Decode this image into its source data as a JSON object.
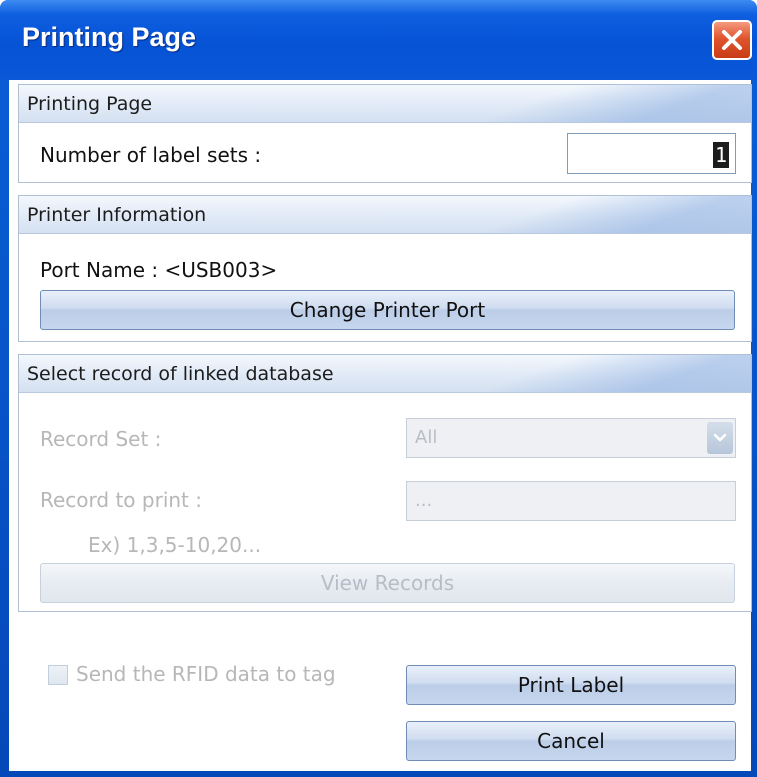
{
  "window": {
    "title": "Printing Page"
  },
  "printing_page": {
    "header": "Printing Page",
    "label_sets_label": "Number of label sets :",
    "label_sets_value": "1"
  },
  "printer_info": {
    "header": "Printer Information",
    "port_name": "Port Name : <USB003>",
    "change_port_button": "Change Printer Port"
  },
  "database": {
    "header": "Select record of linked database",
    "record_set_label": "Record Set :",
    "record_set_value": "All",
    "record_to_print_label": "Record to print :",
    "record_to_print_value": "...",
    "example_text": "Ex) 1,3,5-10,20...",
    "view_records_button": "View Records"
  },
  "rfid": {
    "checkbox_label": "Send the RFID data to tag",
    "checked": false
  },
  "actions": {
    "print_button": "Print Label",
    "cancel_button": "Cancel"
  },
  "icons": {
    "close": "close-icon",
    "dropdown": "chevron-down-icon"
  },
  "colors": {
    "titlebar": "#0653d6",
    "close_button": "#e0552e",
    "group_header": "#e2ebf7",
    "disabled_text": "#b7b7b7"
  }
}
